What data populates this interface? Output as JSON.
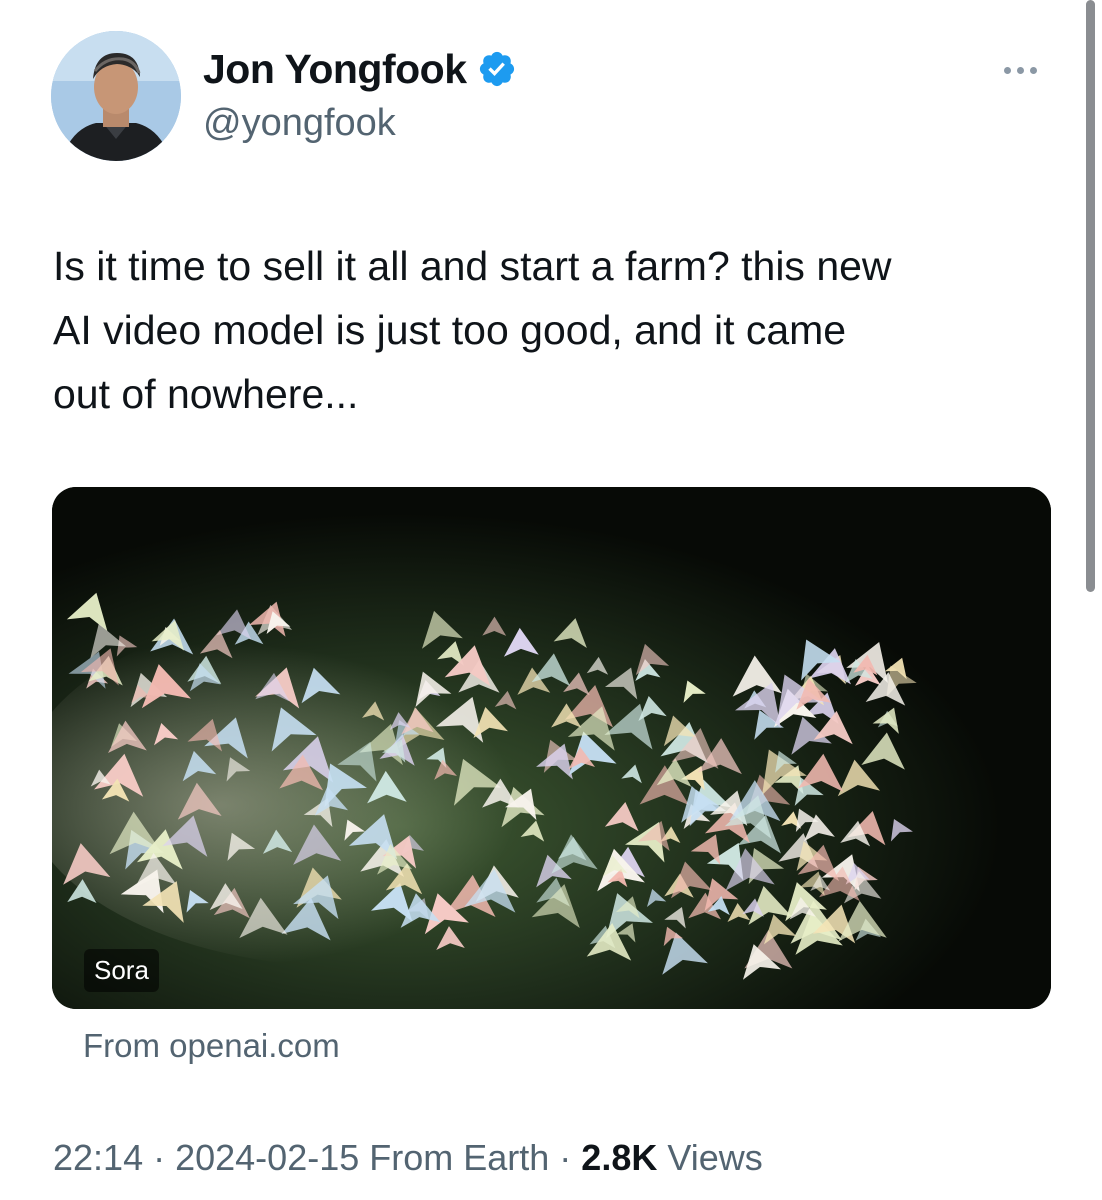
{
  "author": {
    "name": "Jon Yongfook",
    "handle": "@yongfook",
    "verified_icon": "verified-badge-icon",
    "verified_color": "#1d9bf0"
  },
  "tweet": {
    "text": "Is it time to sell it all and start a farm? this new\nAI video model is just too good, and it came\nout of nowhere..."
  },
  "media": {
    "label": "Sora",
    "source": "From openai.com"
  },
  "meta": {
    "time": "22:14",
    "sep1": " · ",
    "date": "2024-02-15",
    "location": " From Earth",
    "sep2": " · ",
    "views_count": "2.8K",
    "views_label": " Views"
  },
  "colors": {
    "text": "#0f1419",
    "secondary": "#536471",
    "accent": "#1d9bf0"
  }
}
